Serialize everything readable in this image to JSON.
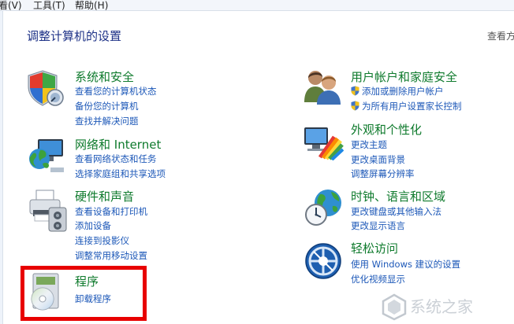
{
  "menubar": {
    "items": [
      {
        "label": "看(V)"
      },
      {
        "label": "工具(T)"
      },
      {
        "label": "帮助(H)"
      }
    ]
  },
  "header": {
    "title": "调整计算机的设置",
    "view_by": "查看方"
  },
  "categories": {
    "system_security": {
      "title": "系统和安全",
      "icon": "shield-flag-icon",
      "links": [
        "查看您的计算机状态",
        "备份您的计算机",
        "查找并解决问题"
      ]
    },
    "network": {
      "title": "网络和 Internet",
      "icon": "globe-network-icon",
      "links": [
        "查看网络状态和任务",
        "选择家庭组和共享选项"
      ]
    },
    "hardware_sound": {
      "title": "硬件和声音",
      "icon": "printer-speaker-icon",
      "links": [
        "查看设备和打印机",
        "添加设备",
        "连接到投影仪",
        "调整常用移动设置"
      ]
    },
    "programs": {
      "title": "程序",
      "icon": "program-disc-icon",
      "links": [
        "卸载程序"
      ]
    },
    "user_accounts": {
      "title": "用户帐户和家庭安全",
      "icon": "users-icon",
      "links": [
        "添加或删除用户帐户",
        "为所有用户设置家长控制"
      ]
    },
    "appearance": {
      "title": "外观和个性化",
      "icon": "monitor-palette-icon",
      "links": [
        "更改主题",
        "更改桌面背景",
        "调整屏幕分辨率"
      ]
    },
    "clock_region": {
      "title": "时钟、语言和区域",
      "icon": "clock-globe-icon",
      "links": [
        "更改键盘或其他输入法",
        "更改显示语言"
      ]
    },
    "ease_access": {
      "title": "轻松访问",
      "icon": "ease-of-access-icon",
      "links": [
        "使用 Windows 建议的设置",
        "优化视频显示"
      ]
    }
  },
  "watermark": {
    "text": "系统之家"
  },
  "colors": {
    "title_green": "#0e7a2c",
    "link_blue": "#1d58b8",
    "header_blue": "#1e3287",
    "highlight_red": "#e80000"
  }
}
